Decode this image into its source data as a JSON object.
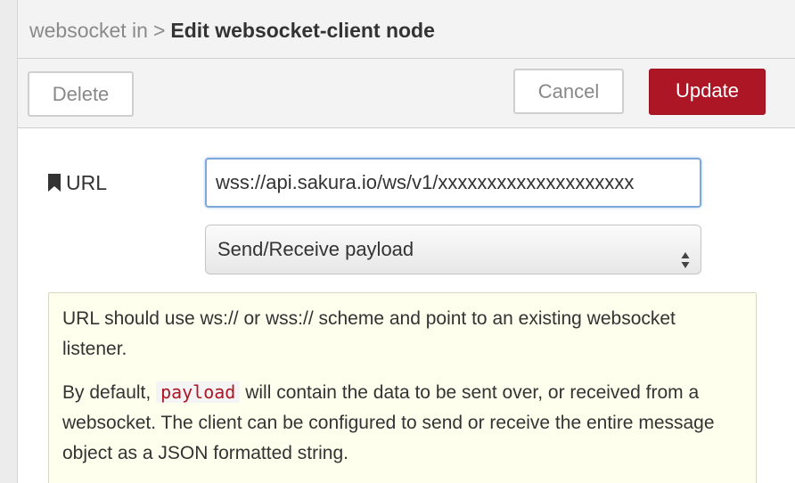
{
  "header": {
    "breadcrumb_parent": "websocket in",
    "breadcrumb_separator": ">",
    "title": "Edit websocket-client node"
  },
  "toolbar": {
    "delete_label": "Delete",
    "cancel_label": "Cancel",
    "update_label": "Update"
  },
  "form": {
    "url_label": "URL",
    "url_icon": "bookmark-icon",
    "url_value": "wss://api.sakura.io/ws/v1/xxxxxxxxxxxxxxxxxxxx",
    "payload_select_value": "Send/Receive payload"
  },
  "help": {
    "para1": "URL should use ws:// or wss:// scheme and point to an existing websocket listener.",
    "para2_before": "By default, ",
    "para2_code": "payload",
    "para2_after": " will contain the data to be sent over, or received from a websocket. The client can be configured to send or receive the entire message object as a JSON formatted string."
  },
  "colors": {
    "accent_update": "#ad1625",
    "focus_border": "#7ea8dc",
    "help_background": "#ffffee"
  }
}
